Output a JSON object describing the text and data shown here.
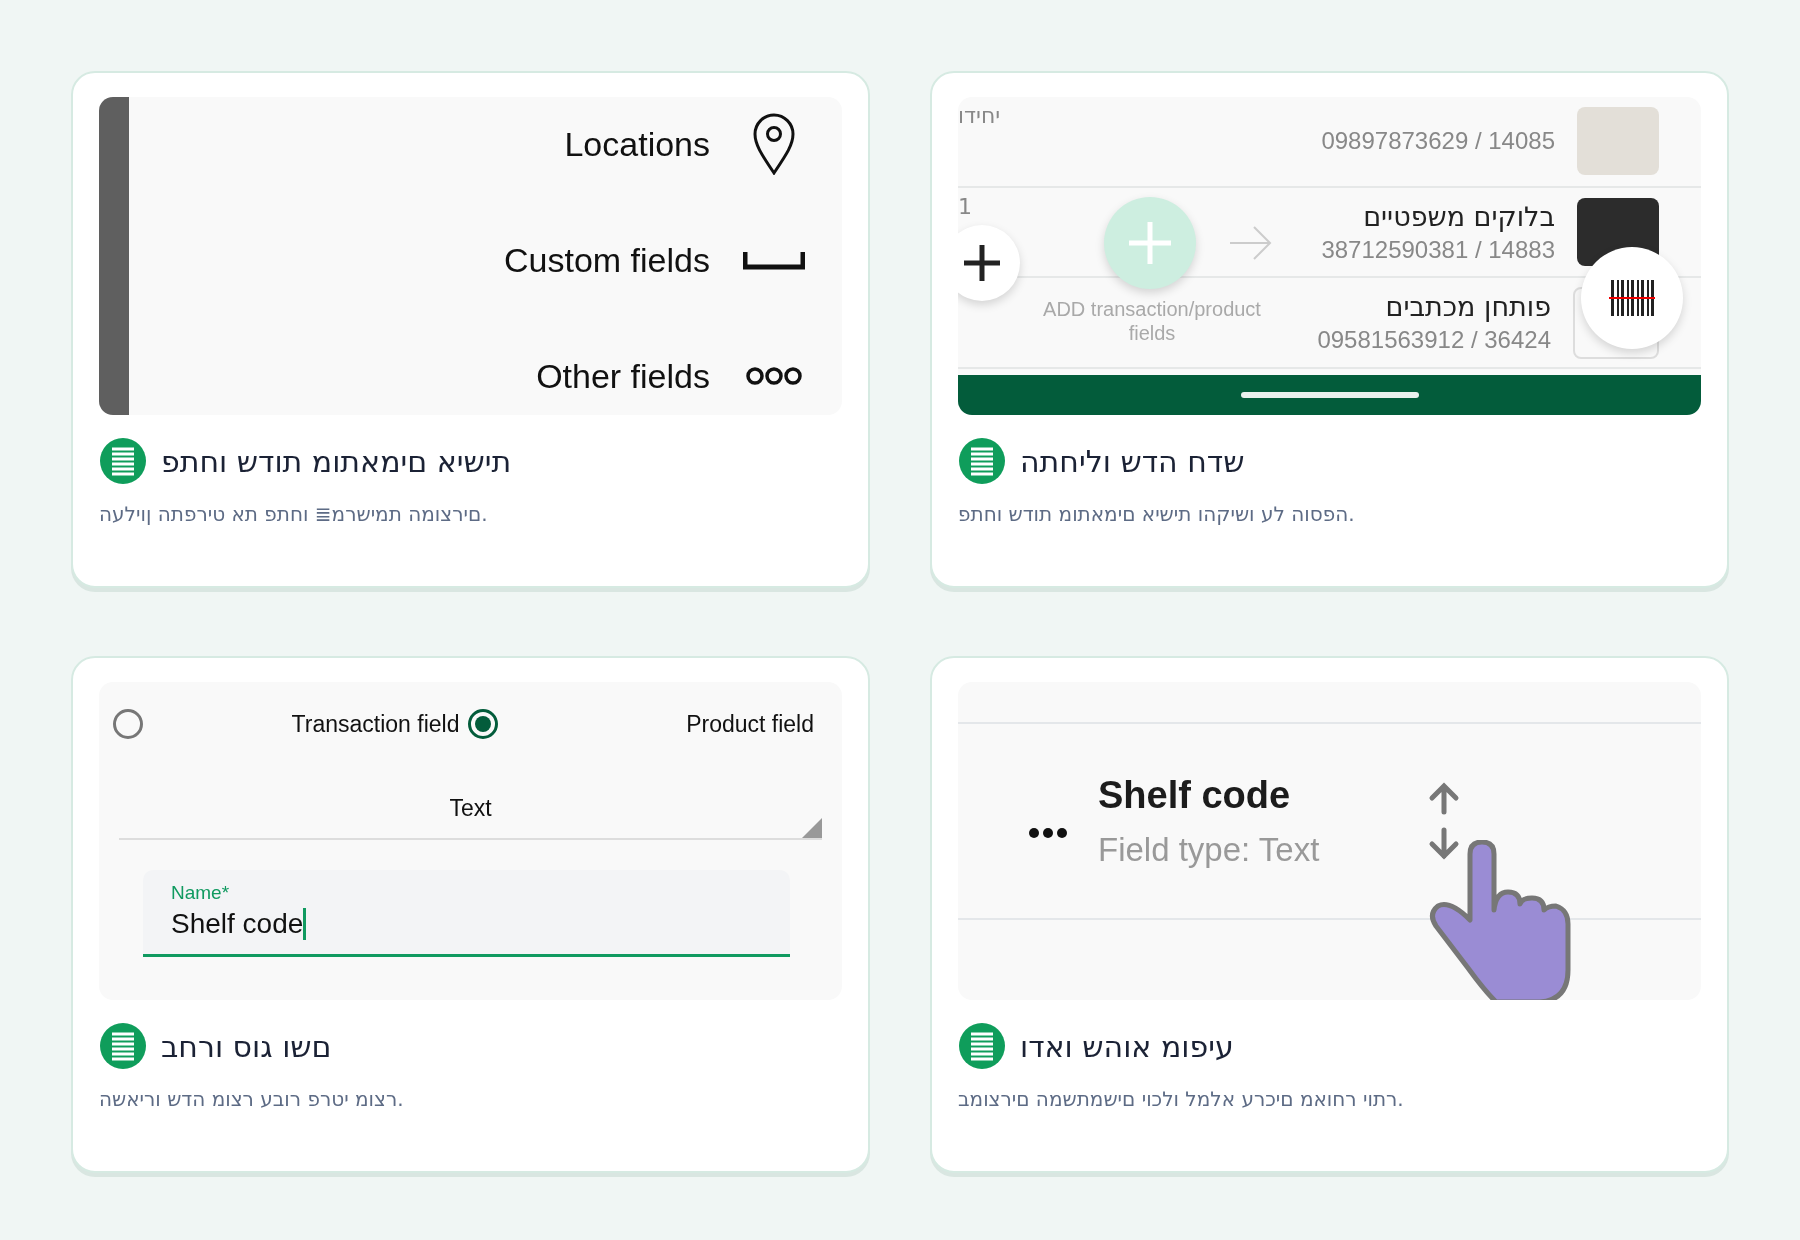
{
  "cards": [
    {
      "kind": "products",
      "preview": {
        "rows": [
          {
            "code": "09897873629 / 14085",
            "side": "יחידו"
          },
          {
            "name": "בלוקים משפטיים",
            "code": "38712590381 / 14883",
            "side": "1"
          },
          {
            "name": "פותחן מכתבים",
            "code": "09581563912 / 36424"
          }
        ],
        "overlay": "ADD transaction/product fields"
      },
      "title": "שדח הדש וליחתה",
      "description": "הפסוה לע ושיקהו תישיא םימאתומ תודש וחתפ."
    },
    {
      "kind": "menu",
      "preview": {
        "items": [
          {
            "label": "Locations"
          },
          {
            "label": "Custom fields"
          },
          {
            "label": "Other fields"
          }
        ]
      },
      "title": "תישיא םימאתומ תודש וחתפ",
      "description": "םירצומה תמישרמ≣ וחתפ תא טירפתה ןוילעה."
    },
    {
      "kind": "reorder",
      "preview": {
        "name": "Shelf code",
        "subtitle": "Field type: Text"
      },
      "title": "עיפומ אוהש ואדו",
      "description": "רתוי רחואמ םיכרע אלמל ולכוי םישמתשמה םירצומב."
    },
    {
      "kind": "form",
      "preview": {
        "options": [
          {
            "label": "Product field",
            "selected": true
          },
          {
            "label": "Transaction field",
            "selected": false
          }
        ],
        "type_value": "Text",
        "name_label": "Name*",
        "name_value": "Shelf code"
      },
      "title": "םשו גוס ורחב",
      "description": "רצומ יטרפ רובע רצומ הדש וריאשה."
    }
  ]
}
